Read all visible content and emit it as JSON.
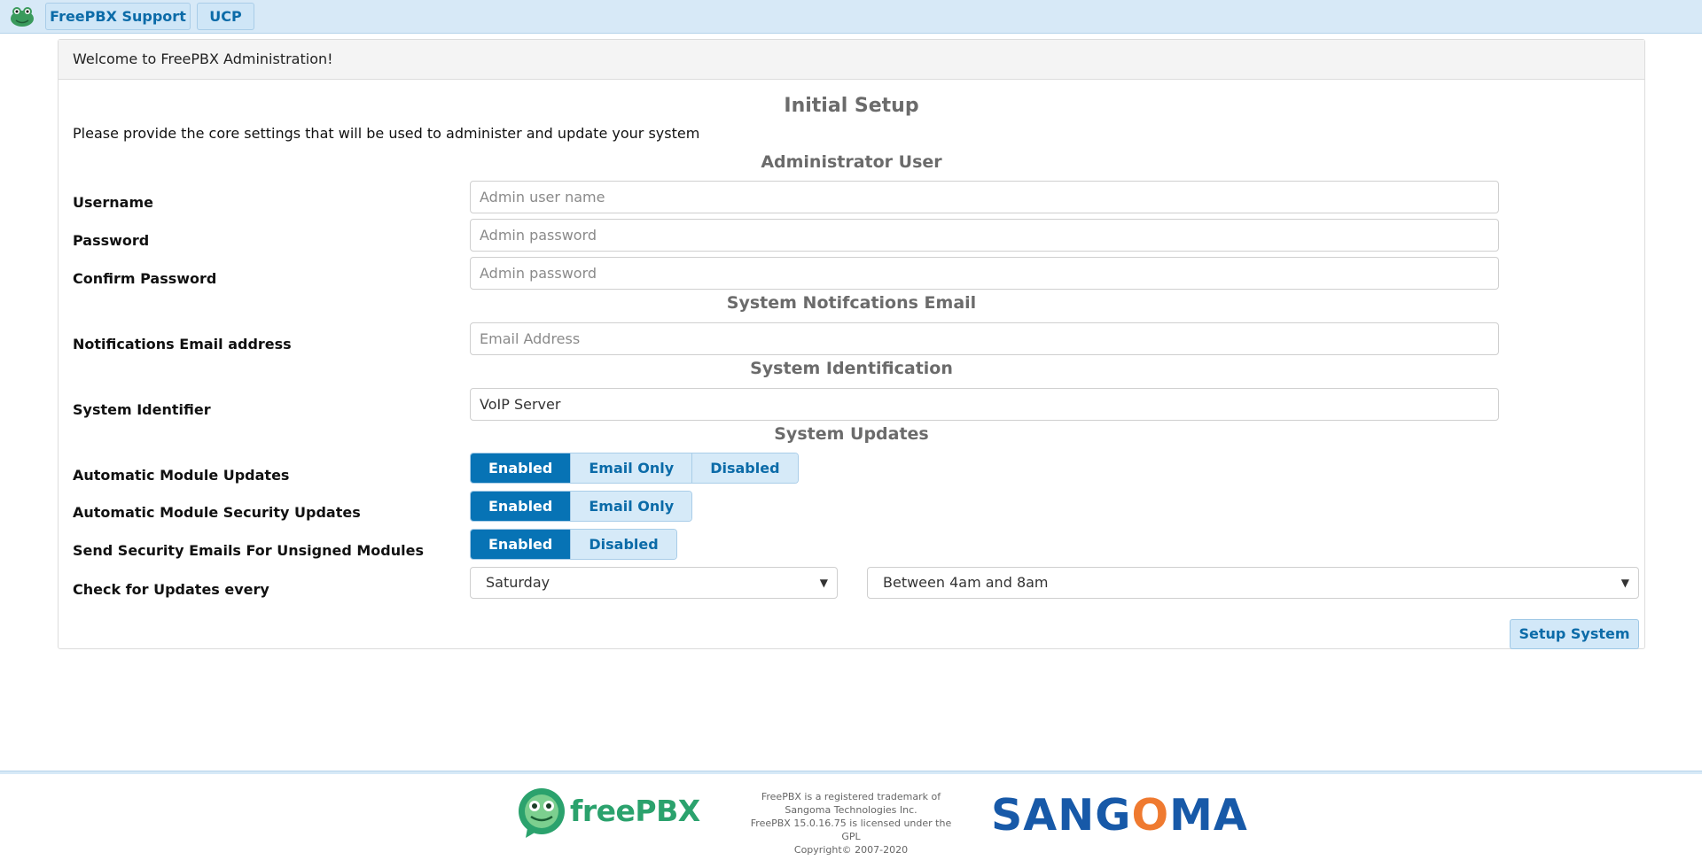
{
  "topbar": {
    "support_label": "FreePBX Support",
    "ucp_label": "UCP"
  },
  "panel": {
    "heading": "Welcome to FreePBX Administration!",
    "title": "Initial Setup",
    "intro": "Please provide the core settings that will be used to administer and update your system"
  },
  "sections": {
    "admin": "Administrator User",
    "notifications": "System Notifcations Email",
    "identification": "System Identification",
    "updates": "System Updates"
  },
  "fields": {
    "username": {
      "label": "Username",
      "placeholder": "Admin user name",
      "value": ""
    },
    "password": {
      "label": "Password",
      "placeholder": "Admin password",
      "value": ""
    },
    "confirm_password": {
      "label": "Confirm Password",
      "placeholder": "Admin password",
      "value": ""
    },
    "email": {
      "label": "Notifications Email address",
      "placeholder": "Email Address",
      "value": ""
    },
    "system_identifier": {
      "label": "System Identifier",
      "placeholder": "",
      "value": "VoIP Server"
    }
  },
  "updates": {
    "auto_module": {
      "label": "Automatic Module Updates",
      "options": [
        "Enabled",
        "Email Only",
        "Disabled"
      ],
      "selected": "Enabled"
    },
    "auto_security": {
      "label": "Automatic Module Security Updates",
      "options": [
        "Enabled",
        "Email Only"
      ],
      "selected": "Enabled"
    },
    "unsigned_emails": {
      "label": "Send Security Emails For Unsigned Modules",
      "options": [
        "Enabled",
        "Disabled"
      ],
      "selected": "Enabled"
    },
    "check_every": {
      "label": "Check for Updates every",
      "day": "Saturday",
      "time": "Between 4am and 8am"
    }
  },
  "setup_button": "Setup System",
  "footer": {
    "freepbx_word": "freePBX",
    "sangoma_pre": "SANG",
    "sangoma_o": "O",
    "sangoma_post": "MA",
    "lines": [
      "FreePBX is a registered trademark of",
      "Sangoma Technologies Inc.",
      "FreePBX 15.0.16.75 is licensed under the GPL",
      "Copyright© 2007-2020"
    ]
  },
  "colors": {
    "accent": "#0773b5",
    "topbar": "#d7e9f7",
    "freepbx_green": "#2ba26d",
    "sangoma_blue": "#1759a8",
    "sangoma_orange": "#ef7a30"
  }
}
